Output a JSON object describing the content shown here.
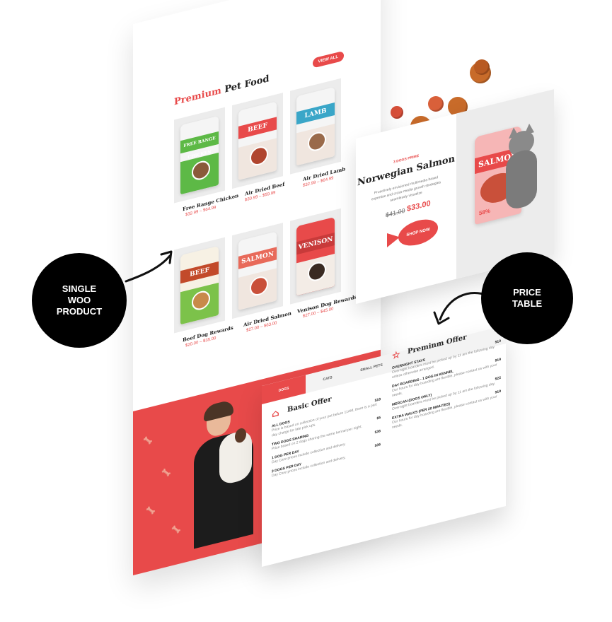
{
  "grid": {
    "view_all": "VIEW ALL",
    "title_accent": "Premium",
    "title_rest": " Pet Food",
    "products": [
      {
        "band": "FREE RANGE CHICKEN",
        "name": "Free Range Chicken",
        "price": "$32.99 – $64.99",
        "color": "#5db946"
      },
      {
        "band": "BEEF",
        "name": "Air Dried Beef",
        "price": "$30.99 – $59.99",
        "color": "#e84a4a"
      },
      {
        "band": "LAMB",
        "name": "Air Dried Lamb",
        "price": "$32.99 – $64.99",
        "color": "#3aa6c8"
      },
      {
        "band": "BEEF",
        "name": "Beef Dog Rewards",
        "price": "$20.00 – $35.00",
        "color": "#7cc24a"
      },
      {
        "band": "SALMON",
        "name": "Air Dried Salmon",
        "price": "$27.00 – $63.00",
        "color": "#e86a5a"
      },
      {
        "band": "VENISON",
        "name": "Venison Dog Rewards",
        "price": "$27.00 – $45.00",
        "color": "#e84a4a"
      }
    ]
  },
  "single": {
    "tag": "3 DOGS PRIME",
    "title": "Norwegian Salmon",
    "description": "Proactively envisioned multimedia based expertise and cross-media growth strategies seamlessly visualize",
    "old_price": "$41.00",
    "new_price": "$33.00",
    "shop_now": "SHOP NOW",
    "bag_band": "SALMON",
    "bag_pct": "58%"
  },
  "price_table": {
    "tabs": [
      "DOGS",
      "CATS",
      "SMALL PETS"
    ],
    "basic": {
      "title": "Basic Offer",
      "rows": [
        {
          "name": "ALL DOGS",
          "price": "$18",
          "desc": "Price is based on collection of your pet before 11AM, there is a part day charge for late pick ups."
        },
        {
          "name": "TWO DOGS SHARING",
          "price": "$5",
          "desc": "Price based on 2 dogs sharing the same kennel per night."
        },
        {
          "name": "1 DOG PER DAY",
          "price": "$36",
          "desc": "Day Care prices include collection and delivery."
        },
        {
          "name": "2 DOGS PER DAY",
          "price": "$36",
          "desc": "Day Care prices include collection and delivery."
        }
      ]
    },
    "premium": {
      "title": "Preminm Offer",
      "rows": [
        {
          "name": "OVERNIGHT STAYS",
          "price": "$10",
          "desc": "Overnight boarders must be picked up by 11 am the following day unless otherwise arranged."
        },
        {
          "name": "DAY BOARDING - 1 DOG IN KENNEL",
          "price": "$19",
          "desc": "Our hours for day boarding are flexible, please contact us with your needs."
        },
        {
          "name": "MERCAN (DOGS ONLY)",
          "price": "$22",
          "desc": "Overnight boarders must be picked up by 11 am the following day."
        },
        {
          "name": "EXTRA WALKS (PER 20 MINUTES)",
          "price": "$19",
          "desc": "Our hours for day boarding are flexible, please contact us with your needs."
        }
      ]
    }
  },
  "badges": {
    "single_woo": "SINGLE\nWOO\nPRODUCT",
    "price_table": "PRICE\nTABLE"
  },
  "colors": {
    "accent": "#e84a4a",
    "badge": "#000000"
  }
}
